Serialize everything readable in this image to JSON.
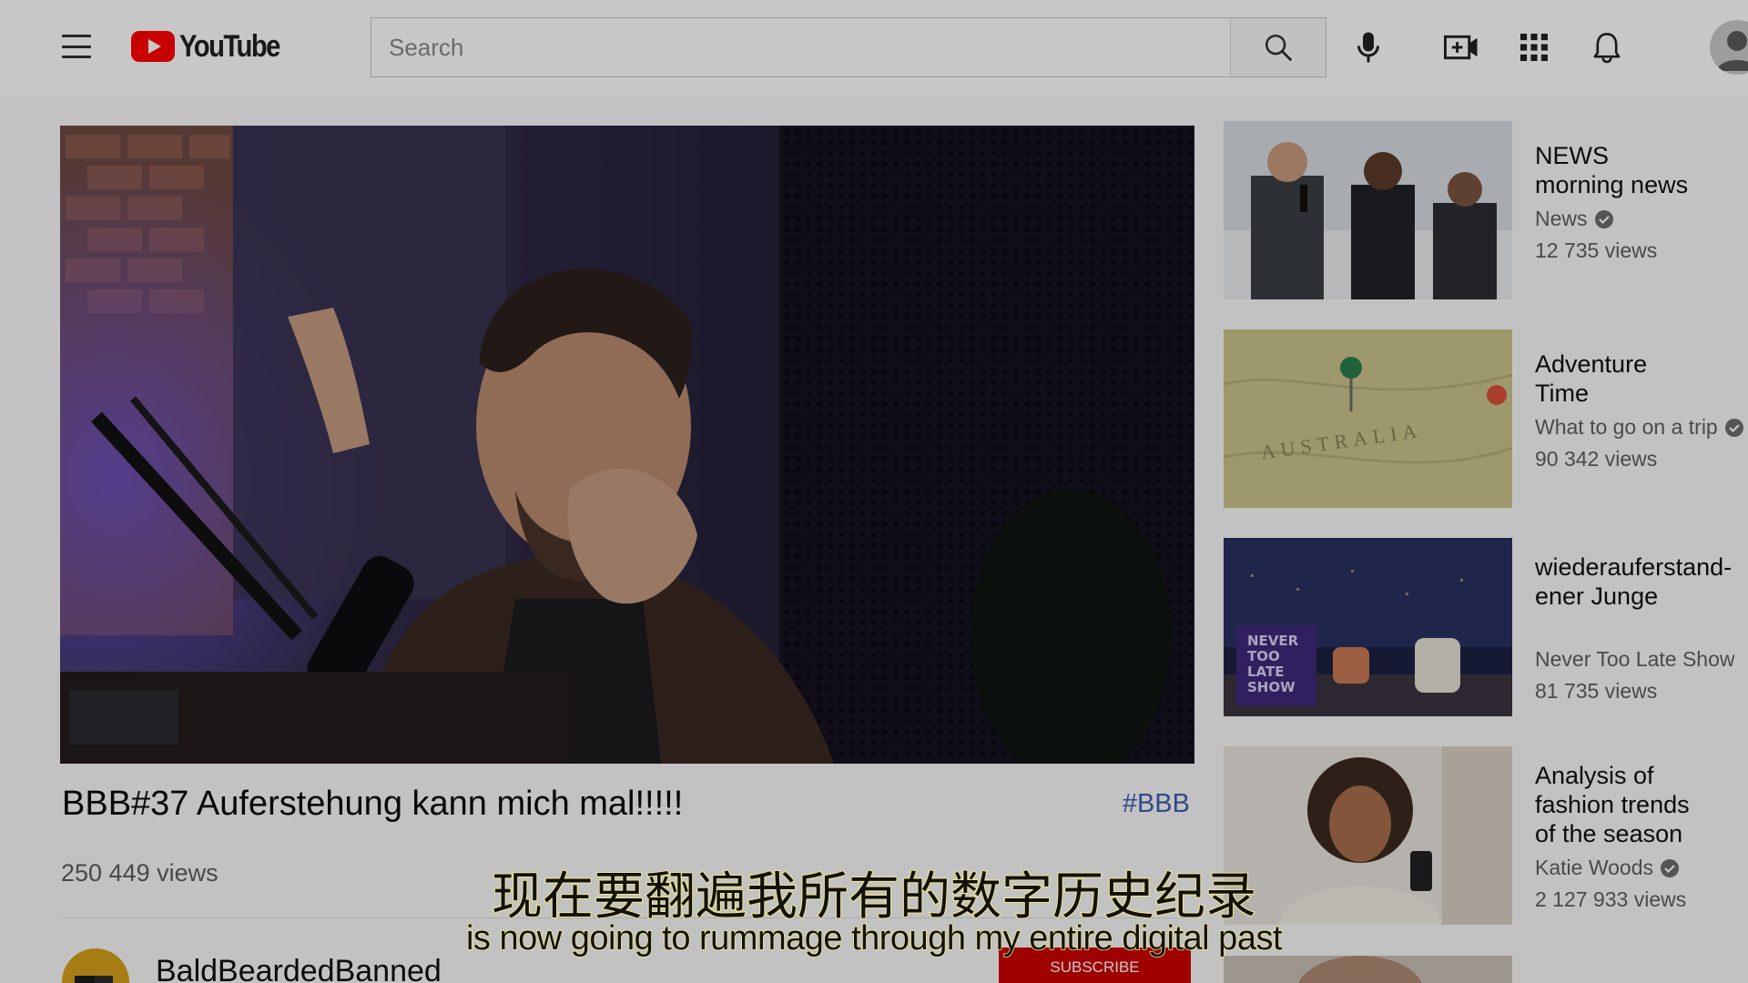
{
  "header": {
    "logo_text": "YouTube",
    "search_placeholder": "Search"
  },
  "video": {
    "title": "BBB#37 Auferstehung kann mich mal!!!!!",
    "hashtag": "#BBB",
    "views": "250 449 views",
    "channel_name": "BaldBeardedBanned",
    "subscribe_label": "SUBSCRIBE"
  },
  "recommendations": [
    {
      "title": "NEWS\nmorning news",
      "channel": "News",
      "verified": true,
      "views": "12 735 views"
    },
    {
      "title": "Adventure\nTime",
      "channel": "What to go on a trip",
      "verified": true,
      "views": "90 342 views"
    },
    {
      "title": "wiederauferstand-\nener Junge",
      "channel": "Never Too Late Show",
      "verified": false,
      "views": "81 735 views"
    },
    {
      "title": "Analysis of\nfashion trends\nof the season",
      "channel": "Katie Woods",
      "verified": true,
      "views": "2 127 933 views"
    }
  ],
  "thumbnail_text": {
    "map_label": "AUSTRALIA",
    "show_sign": "NEVER\nTOO\nLATE\nSHOW"
  },
  "subtitles": {
    "zh": "现在要翻遍我所有的数字历史纪录",
    "en": "is now going to rummage through my entire digital past"
  },
  "colors": {
    "brand_red": "#ff0000",
    "subscribe_red": "#cc0000",
    "hashtag_blue": "#3d5eb0",
    "subtitle_outline": "#f2e98a"
  },
  "icons": [
    "menu-icon",
    "youtube-logo-icon",
    "search-icon",
    "microphone-icon",
    "create-video-icon",
    "apps-grid-icon",
    "notifications-bell-icon",
    "verified-check-icon"
  ]
}
